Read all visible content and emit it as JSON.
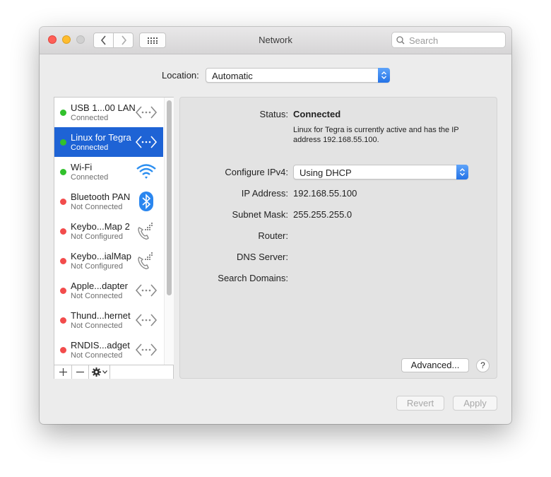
{
  "window": {
    "title": "Network",
    "search_placeholder": "Search"
  },
  "location": {
    "label": "Location:",
    "value": "Automatic"
  },
  "services": [
    {
      "name": "USB 1...00 LAN",
      "status": "Connected",
      "status_color": "#32c12c",
      "icon": "ethernet-arrows-icon",
      "selected": false
    },
    {
      "name": "Linux for Tegra",
      "status": "Connected",
      "status_color": "#32c12c",
      "icon": "ethernet-arrows-icon",
      "selected": true
    },
    {
      "name": "Wi-Fi",
      "status": "Connected",
      "status_color": "#32c12c",
      "icon": "wifi-icon",
      "selected": false
    },
    {
      "name": "Bluetooth PAN",
      "status": "Not Connected",
      "status_color": "#f24c4c",
      "icon": "bluetooth-icon",
      "selected": false
    },
    {
      "name": "Keybo...Map  2",
      "status": "Not Configured",
      "status_color": "#f24c4c",
      "icon": "phone-icon",
      "selected": false
    },
    {
      "name": "Keybo...ialMap",
      "status": "Not Configured",
      "status_color": "#f24c4c",
      "icon": "phone-icon",
      "selected": false
    },
    {
      "name": "Apple...dapter",
      "status": "Not Connected",
      "status_color": "#f24c4c",
      "icon": "ethernet-arrows-icon",
      "selected": false
    },
    {
      "name": "Thund...hernet",
      "status": "Not Connected",
      "status_color": "#f24c4c",
      "icon": "ethernet-arrows-icon",
      "selected": false
    },
    {
      "name": "RNDIS...adget",
      "status": "Not Connected",
      "status_color": "#f24c4c",
      "icon": "ethernet-arrows-icon",
      "selected": false
    }
  ],
  "detail": {
    "status_label": "Status:",
    "status_value": "Connected",
    "status_description": "Linux for Tegra is currently active and has the IP address 192.168.55.100.",
    "configure_label": "Configure IPv4:",
    "configure_value": "Using DHCP",
    "ip_label": "IP Address:",
    "ip_value": "192.168.55.100",
    "subnet_label": "Subnet Mask:",
    "subnet_value": "255.255.255.0",
    "router_label": "Router:",
    "router_value": "",
    "dns_label": "DNS Server:",
    "dns_value": "",
    "search_domains_label": "Search Domains:",
    "search_domains_value": "",
    "advanced_label": "Advanced...",
    "help_label": "?"
  },
  "footer": {
    "revert_label": "Revert",
    "apply_label": "Apply"
  },
  "colors": {
    "selection": "#1e63d5",
    "connected": "#32c12c",
    "disconnected": "#f24c4c",
    "accent": "#2573e6"
  }
}
